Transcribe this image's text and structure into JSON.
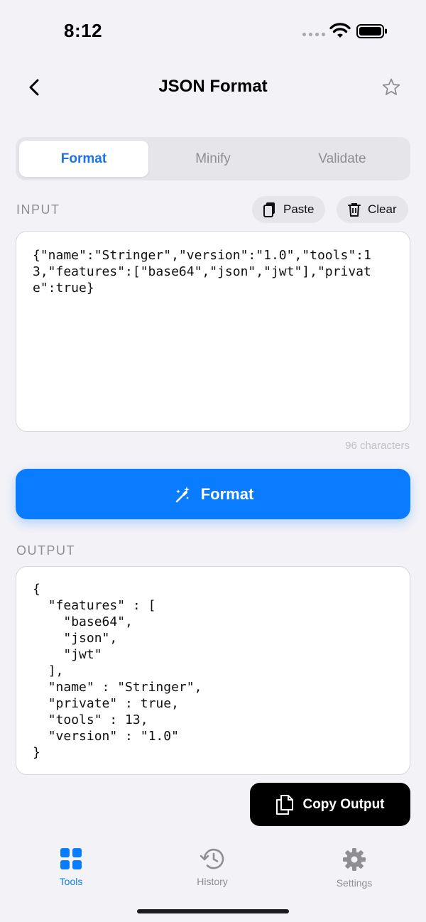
{
  "status": {
    "time": "8:12"
  },
  "nav": {
    "title": "JSON Format"
  },
  "tabs": [
    {
      "label": "Format",
      "active": true
    },
    {
      "label": "Minify",
      "active": false
    },
    {
      "label": "Validate",
      "active": false
    }
  ],
  "input": {
    "label": "INPUT",
    "paste_label": "Paste",
    "clear_label": "Clear",
    "value": "{\"name\":\"Stringer\",\"version\":\"1.0\",\"tools\":13,\"features\":[\"base64\",\"json\",\"jwt\"],\"private\":true}",
    "char_count": "96 characters"
  },
  "format_button": {
    "label": "Format"
  },
  "output": {
    "label": "OUTPUT",
    "value": "{\n  \"features\" : [\n    \"base64\",\n    \"json\",\n    \"jwt\"\n  ],\n  \"name\" : \"Stringer\",\n  \"private\" : true,\n  \"tools\" : 13,\n  \"version\" : \"1.0\"\n}"
  },
  "copy_button": {
    "label": "Copy Output"
  },
  "tab_bar": {
    "items": [
      {
        "label": "Tools",
        "icon": "grid-icon",
        "active": true
      },
      {
        "label": "History",
        "icon": "history-icon",
        "active": false
      },
      {
        "label": "Settings",
        "icon": "gear-icon",
        "active": false
      }
    ]
  },
  "colors": {
    "accent": "#0a7cff",
    "background": "#f2f2f7",
    "inactive": "#8e8e93"
  }
}
